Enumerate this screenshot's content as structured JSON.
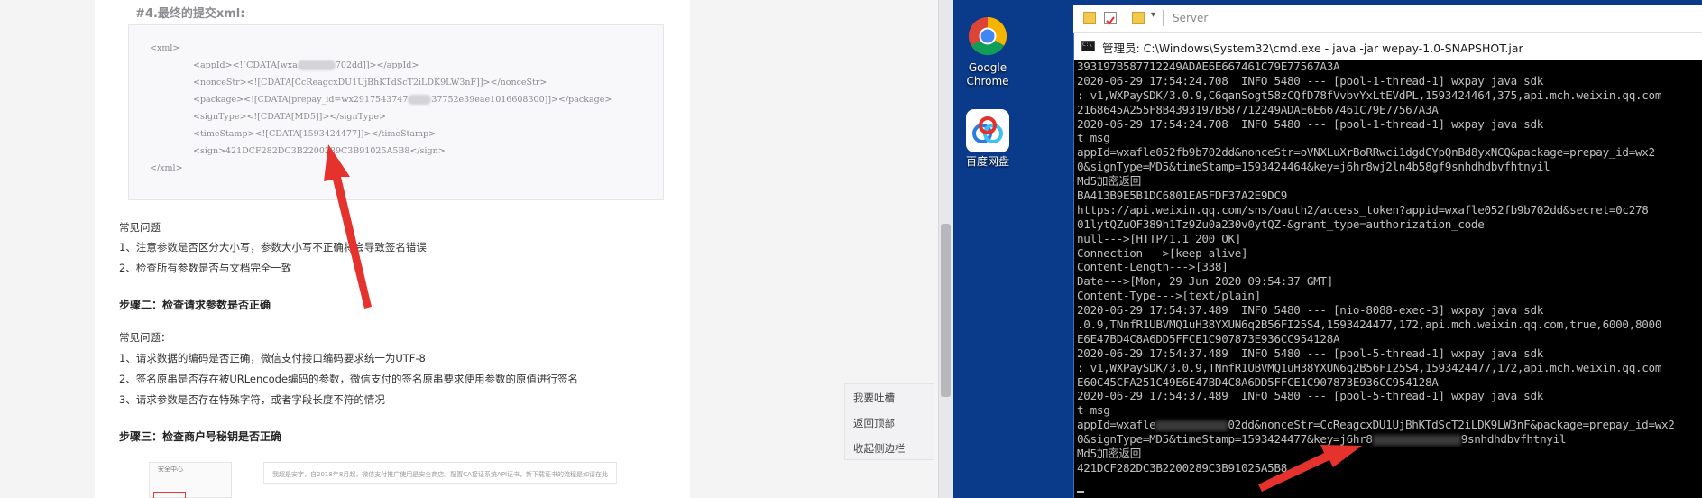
{
  "doc": {
    "step4_heading": "#4.最终的提交xml:",
    "xml": {
      "open": "<xml>",
      "appid_pre": "<appId><![CDATA[wxa",
      "appid_post": "702dd]]></appId>",
      "noncestr": "<nonceStr><![CDATA[CcReagcxDU1UjBhKTdScT2iLDK9LW3nF]]></nonceStr>",
      "package_pre": "<package><![CDATA[prepay_id=wx2917543747",
      "package_post": "37752e39eae1016608300]]></package>",
      "signtype": "<signType><![CDATA[MD5]]></signType>",
      "timestamp": "<timeStamp><![CDATA[1593424477]]></timeStamp>",
      "sign": "<sign>421DCF282DC3B2200289C3B91025A5B8</sign>",
      "close": "</xml>"
    },
    "faq1_title": "常见问题",
    "faq1_items": [
      "1、注意参数是否区分大小写，参数大小写不正确将会导致签名错误",
      "2、检查所有参数是否与文档完全一致"
    ],
    "step2_heading": "步骤二：检查请求参数是否正确",
    "faq2_title": "常见问题：",
    "faq2_items": [
      "1、请求数据的编码是否正确，微信支付接口编码要求统一为UTF-8",
      "2、签名原串是否存在被URLencode编码的参数，微信支付的签名原串要求使用参数的原值进行签名",
      "3、请求参数是否存在特殊字符，或者字段长度不符的情况"
    ],
    "step3_heading": "步骤三：检查商户号秘钥是否正确",
    "thumb_side_label": "安全中心",
    "thumb_main_text": "我超是安字，自2018年8月起，微信支付推广使用是安全商店。配置CA接证系统API证书，新下载证书的流程是如请在此"
  },
  "float_menu": [
    "我要吐槽",
    "返回顶部",
    "收起侧边栏"
  ],
  "desktop_icons": [
    {
      "label_line1": "Google",
      "label_line2": "Chrome",
      "icon": "chrome-icon"
    },
    {
      "label_line1": "百度网盘",
      "label_line2": "",
      "icon": "baidu-netdisk-icon"
    }
  ],
  "explorer": {
    "address": "Server"
  },
  "cmd": {
    "title": "管理员: C:\\Windows\\System32\\cmd.exe - java  -jar wepay-1.0-SNAPSHOT.jar",
    "icon_text": "C:\\",
    "lines": [
      "393197B587712249ADAE6E667461C79E77567A3A",
      "2020-06-29 17:54:24.708  INFO 5480 --- [pool-1-thread-1] wxpay java sdk",
      ": v1,WXPaySDK/3.0.9,C6qanSogt58zCQfD78fVvbvYxLtEVdPL,1593424464,375,api.mch.weixin.qq.com",
      "2168645A255F8B4393197B587712249ADAE6E667461C79E77567A3A",
      "2020-06-29 17:54:24.708  INFO 5480 --- [pool-1-thread-1] wxpay java sdk",
      "t msg",
      "appId=wxafle052fb9b702dd&nonceStr=oVNXLuXrBoRRwci1dgdCYpQnBd8yxNCQ&package=prepay_id=wx2",
      "0&signType=MD5&timeStamp=1593424464&key=j6hr8wj2ln4b58gf9snhdhdbvfhtnyil",
      "Md5加密返回",
      "BA413B9E5B1DC6801EA5FDF37A2E9DC9",
      "https://api.weixin.qq.com/sns/oauth2/access_token?appid=wxafle052fb9b702dd&secret=0c278",
      "01lytQZuOF389h1Tz9Zu0a230v0ytQZ-&grant_type=authorization_code",
      "null--->[HTTP/1.1 200 OK]",
      "Connection--->[keep-alive]",
      "Content-Length--->[338]",
      "Date--->[Mon, 29 Jun 2020 09:54:37 GMT]",
      "Content-Type--->[text/plain]",
      "2020-06-29 17:54:37.489  INFO 5480 --- [nio-8088-exec-3] wxpay java sdk",
      ".0.9,TNnfR1UBVMQ1uH38YXUN6q2B56FI25S4,1593424477,172,api.mch.weixin.qq.com,true,6000,8000",
      "E6E47BD4C8A6DD5FFCE1C907873E936CC954128A",
      "2020-06-29 17:54:37.489  INFO 5480 --- [pool-5-thread-1] wxpay java sdk",
      ": v1,WXPaySDK/3.0.9,TNnfR1UBVMQ1uH38YXUN6q2B56FI25S4,1593424477,172,api.mch.weixin.qq.com",
      "E60C45CFA251C49E6E47BD4C8A6DD5FFCE1C907873E936CC954128A",
      "2020-06-29 17:54:37.489  INFO 5480 --- [pool-5-thread-1] wxpay java sdk",
      "t msg"
    ],
    "line_blur1_pre": "appId=wxafle",
    "line_blur1_post": "02dd&nonceStr=CcReagcxDU1UjBhKTdScT2iLDK9LW3nF&package=prepay_id=wx2",
    "line_blur2_pre": "0&signType=MD5&timeStamp=1593424477&key=j6hr8",
    "line_blur2_post": "9snhdhdbvfhtnyil",
    "line_md5": "Md5加密返回",
    "line_sign": "421DCF282DC3B2200289C3B91025A5B8"
  },
  "colors": {
    "desktop": "#0a3a8a",
    "arrow": "#e5322d",
    "terminal_text": "#c0c0c0"
  }
}
